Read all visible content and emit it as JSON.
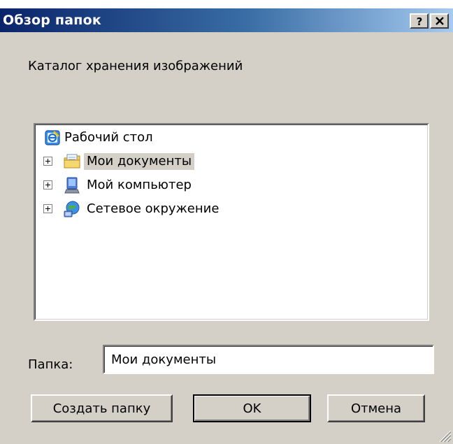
{
  "window": {
    "title": "Обзор папок",
    "help_button": "?",
    "close_button": "✕"
  },
  "caption": "Каталог хранения изображений",
  "tree": {
    "root": {
      "label": "Рабочий стол",
      "icon": "desktop-icon"
    },
    "items": [
      {
        "label": "Мои документы",
        "icon": "my-documents-icon",
        "expandable": true,
        "selected": true
      },
      {
        "label": "Мой компьютер",
        "icon": "my-computer-icon",
        "expandable": true,
        "selected": false
      },
      {
        "label": "Сетевое окружение",
        "icon": "network-places-icon",
        "expandable": true,
        "selected": false
      }
    ]
  },
  "folder": {
    "label": "Папка:",
    "value": "Мои документы"
  },
  "buttons": {
    "new_folder": "Создать папку",
    "ok": "OK",
    "cancel": "Отмена"
  },
  "colors": {
    "title_start": "#0a246a",
    "title_end": "#a6caf0",
    "dialog_bg": "#d4d0c8"
  }
}
